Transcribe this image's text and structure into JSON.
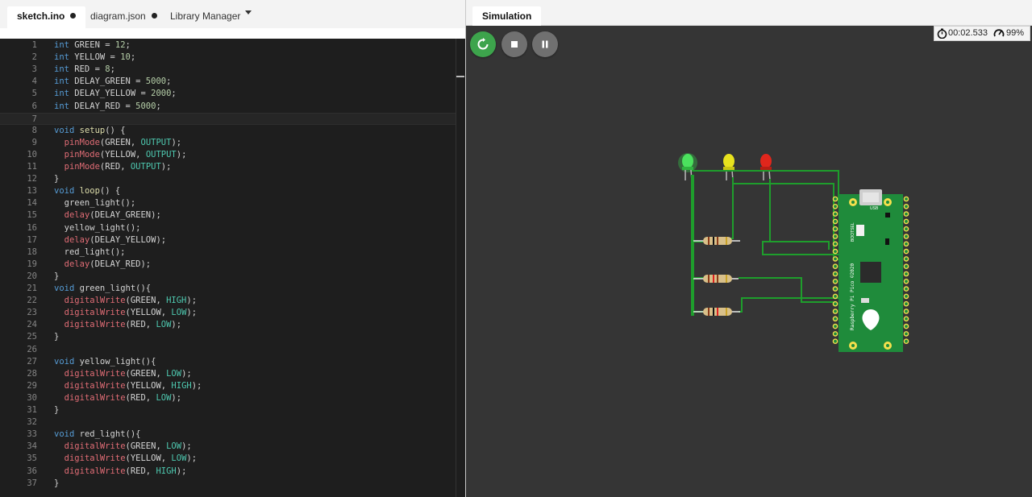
{
  "editor": {
    "tabs": [
      {
        "label": "sketch.ino",
        "modified": true,
        "active": true
      },
      {
        "label": "diagram.json",
        "modified": true,
        "active": false
      },
      {
        "label": "Library Manager",
        "active": false
      }
    ],
    "current_line": 7,
    "lines": [
      [
        [
          "kw",
          "int"
        ],
        [
          "t",
          " GREEN = "
        ],
        [
          "nm",
          "12"
        ],
        [
          "t",
          ";"
        ]
      ],
      [
        [
          "kw",
          "int"
        ],
        [
          "t",
          " YELLOW = "
        ],
        [
          "nm",
          "10"
        ],
        [
          "t",
          ";"
        ]
      ],
      [
        [
          "kw",
          "int"
        ],
        [
          "t",
          " RED = "
        ],
        [
          "nm",
          "8"
        ],
        [
          "t",
          ";"
        ]
      ],
      [
        [
          "kw",
          "int"
        ],
        [
          "t",
          " DELAY_GREEN = "
        ],
        [
          "nm",
          "5000"
        ],
        [
          "t",
          ";"
        ]
      ],
      [
        [
          "kw",
          "int"
        ],
        [
          "t",
          " DELAY_YELLOW = "
        ],
        [
          "nm",
          "2000"
        ],
        [
          "t",
          ";"
        ]
      ],
      [
        [
          "kw",
          "int"
        ],
        [
          "t",
          " DELAY_RED = "
        ],
        [
          "nm",
          "5000"
        ],
        [
          "t",
          ";"
        ]
      ],
      [],
      [
        [
          "kw",
          "void"
        ],
        [
          "t",
          " "
        ],
        [
          "fn",
          "setup"
        ],
        [
          "t",
          "() {"
        ]
      ],
      [
        [
          "t",
          "  "
        ],
        [
          "ar",
          "pinMode"
        ],
        [
          "t",
          "(GREEN, "
        ],
        [
          "cs",
          "OUTPUT"
        ],
        [
          "t",
          ");"
        ]
      ],
      [
        [
          "t",
          "  "
        ],
        [
          "ar",
          "pinMode"
        ],
        [
          "t",
          "(YELLOW, "
        ],
        [
          "cs",
          "OUTPUT"
        ],
        [
          "t",
          ");"
        ]
      ],
      [
        [
          "t",
          "  "
        ],
        [
          "ar",
          "pinMode"
        ],
        [
          "t",
          "(RED, "
        ],
        [
          "cs",
          "OUTPUT"
        ],
        [
          "t",
          ");"
        ]
      ],
      [
        [
          "t",
          "}"
        ]
      ],
      [
        [
          "kw",
          "void"
        ],
        [
          "t",
          " "
        ],
        [
          "fn",
          "loop"
        ],
        [
          "t",
          "() {"
        ]
      ],
      [
        [
          "t",
          "  green_light();"
        ]
      ],
      [
        [
          "t",
          "  "
        ],
        [
          "ar",
          "delay"
        ],
        [
          "t",
          "(DELAY_GREEN);"
        ]
      ],
      [
        [
          "t",
          "  yellow_light();"
        ]
      ],
      [
        [
          "t",
          "  "
        ],
        [
          "ar",
          "delay"
        ],
        [
          "t",
          "(DELAY_YELLOW);"
        ]
      ],
      [
        [
          "t",
          "  red_light();"
        ]
      ],
      [
        [
          "t",
          "  "
        ],
        [
          "ar",
          "delay"
        ],
        [
          "t",
          "(DELAY_RED);"
        ]
      ],
      [
        [
          "t",
          "}"
        ]
      ],
      [
        [
          "kw",
          "void"
        ],
        [
          "t",
          " green_light(){"
        ]
      ],
      [
        [
          "t",
          "  "
        ],
        [
          "ar",
          "digitalWrite"
        ],
        [
          "t",
          "(GREEN, "
        ],
        [
          "cs",
          "HIGH"
        ],
        [
          "t",
          ");"
        ]
      ],
      [
        [
          "t",
          "  "
        ],
        [
          "ar",
          "digitalWrite"
        ],
        [
          "t",
          "(YELLOW, "
        ],
        [
          "cs",
          "LOW"
        ],
        [
          "t",
          ");"
        ]
      ],
      [
        [
          "t",
          "  "
        ],
        [
          "ar",
          "digitalWrite"
        ],
        [
          "t",
          "(RED, "
        ],
        [
          "cs",
          "LOW"
        ],
        [
          "t",
          ");"
        ]
      ],
      [
        [
          "t",
          "}"
        ]
      ],
      [],
      [
        [
          "kw",
          "void"
        ],
        [
          "t",
          " yellow_light(){"
        ]
      ],
      [
        [
          "t",
          "  "
        ],
        [
          "ar",
          "digitalWrite"
        ],
        [
          "t",
          "(GREEN, "
        ],
        [
          "cs",
          "LOW"
        ],
        [
          "t",
          ");"
        ]
      ],
      [
        [
          "t",
          "  "
        ],
        [
          "ar",
          "digitalWrite"
        ],
        [
          "t",
          "(YELLOW, "
        ],
        [
          "cs",
          "HIGH"
        ],
        [
          "t",
          ");"
        ]
      ],
      [
        [
          "t",
          "  "
        ],
        [
          "ar",
          "digitalWrite"
        ],
        [
          "t",
          "(RED, "
        ],
        [
          "cs",
          "LOW"
        ],
        [
          "t",
          ");"
        ]
      ],
      [
        [
          "t",
          "}"
        ]
      ],
      [],
      [
        [
          "kw",
          "void"
        ],
        [
          "t",
          " red_light(){"
        ]
      ],
      [
        [
          "t",
          "  "
        ],
        [
          "ar",
          "digitalWrite"
        ],
        [
          "t",
          "(GREEN, "
        ],
        [
          "cs",
          "LOW"
        ],
        [
          "t",
          ");"
        ]
      ],
      [
        [
          "t",
          "  "
        ],
        [
          "ar",
          "digitalWrite"
        ],
        [
          "t",
          "(YELLOW, "
        ],
        [
          "cs",
          "LOW"
        ],
        [
          "t",
          ");"
        ]
      ],
      [
        [
          "t",
          "  "
        ],
        [
          "ar",
          "digitalWrite"
        ],
        [
          "t",
          "(RED, "
        ],
        [
          "cs",
          "HIGH"
        ],
        [
          "t",
          ");"
        ]
      ],
      [
        [
          "t",
          "}"
        ]
      ]
    ]
  },
  "simulation": {
    "tab_label": "Simulation",
    "controls": [
      {
        "name": "restart-button",
        "icon": "restart-icon"
      },
      {
        "name": "stop-button",
        "icon": "stop-icon"
      },
      {
        "name": "pause-button",
        "icon": "pause-icon"
      }
    ],
    "timer": "00:02.533",
    "speed": "99%",
    "leds": [
      {
        "name": "green",
        "color": "#35d64a",
        "lit": true
      },
      {
        "name": "yellow",
        "color": "#e8e21e",
        "lit": false
      },
      {
        "name": "red",
        "color": "#e0261c",
        "lit": false
      }
    ],
    "board": {
      "label": "Raspberry Pi Pico ©2020",
      "usb_label": "USB",
      "bootsel_label": "BOOTSEL",
      "color": "#1f8b3b"
    },
    "colors": {
      "play_button": "#3da44c",
      "wire": "#1e9e2c",
      "canvas_bg": "#353535"
    }
  }
}
